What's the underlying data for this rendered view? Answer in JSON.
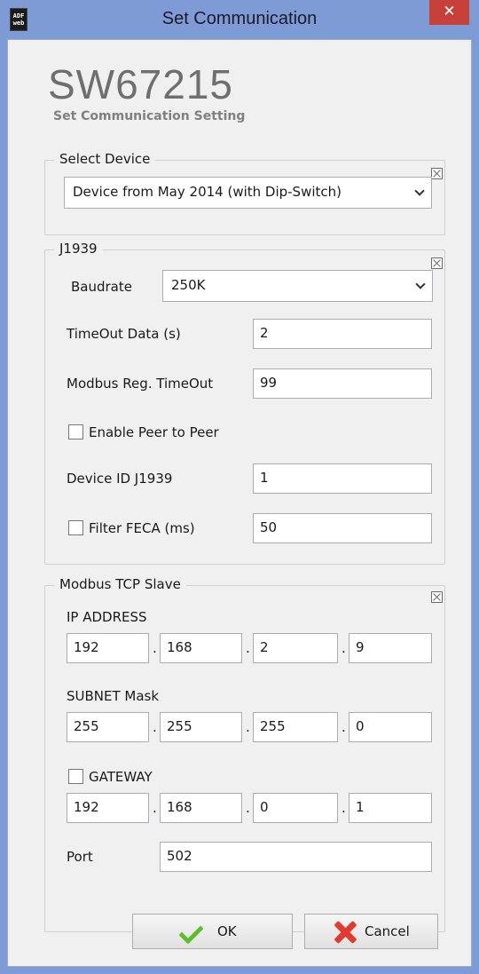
{
  "window": {
    "title": "Set Communication",
    "app_icon_text": "ADF web",
    "close_label": "✕"
  },
  "header": {
    "title": "SW67215",
    "subtitle": "Set Communication Setting"
  },
  "select_device": {
    "legend": "Select Device",
    "device_value": "Device from May 2014 (with Dip-Switch)"
  },
  "j1939": {
    "legend": "J1939",
    "baudrate_label": "Baudrate",
    "baudrate_value": "250K",
    "timeout_label": "TimeOut Data (s)",
    "timeout_value": "2",
    "modbus_timeout_label": "Modbus Reg. TimeOut",
    "modbus_timeout_value": "99",
    "peer_label": "Enable Peer to Peer",
    "peer_checked": false,
    "device_id_label": "Device ID J1939",
    "device_id_value": "1",
    "filter_label": "Filter FECA (ms)",
    "filter_checked": false,
    "filter_value": "50"
  },
  "modbus": {
    "legend": "Modbus TCP Slave",
    "ip_label": "IP ADDRESS",
    "ip": [
      "192",
      "168",
      "2",
      "9"
    ],
    "subnet_label": "SUBNET Mask",
    "subnet": [
      "255",
      "255",
      "255",
      "0"
    ],
    "gateway_label": "GATEWAY",
    "gateway_checked": false,
    "gateway": [
      "192",
      "168",
      "0",
      "1"
    ],
    "port_label": "Port",
    "port_value": "502",
    "dot": "."
  },
  "buttons": {
    "ok_label": "OK",
    "cancel_label": "Cancel"
  },
  "colors": {
    "frame": "#7e9bd6",
    "close": "#c7413a",
    "ok_icon": "#5cbf2a",
    "cancel_icon": "#e03b2e"
  }
}
